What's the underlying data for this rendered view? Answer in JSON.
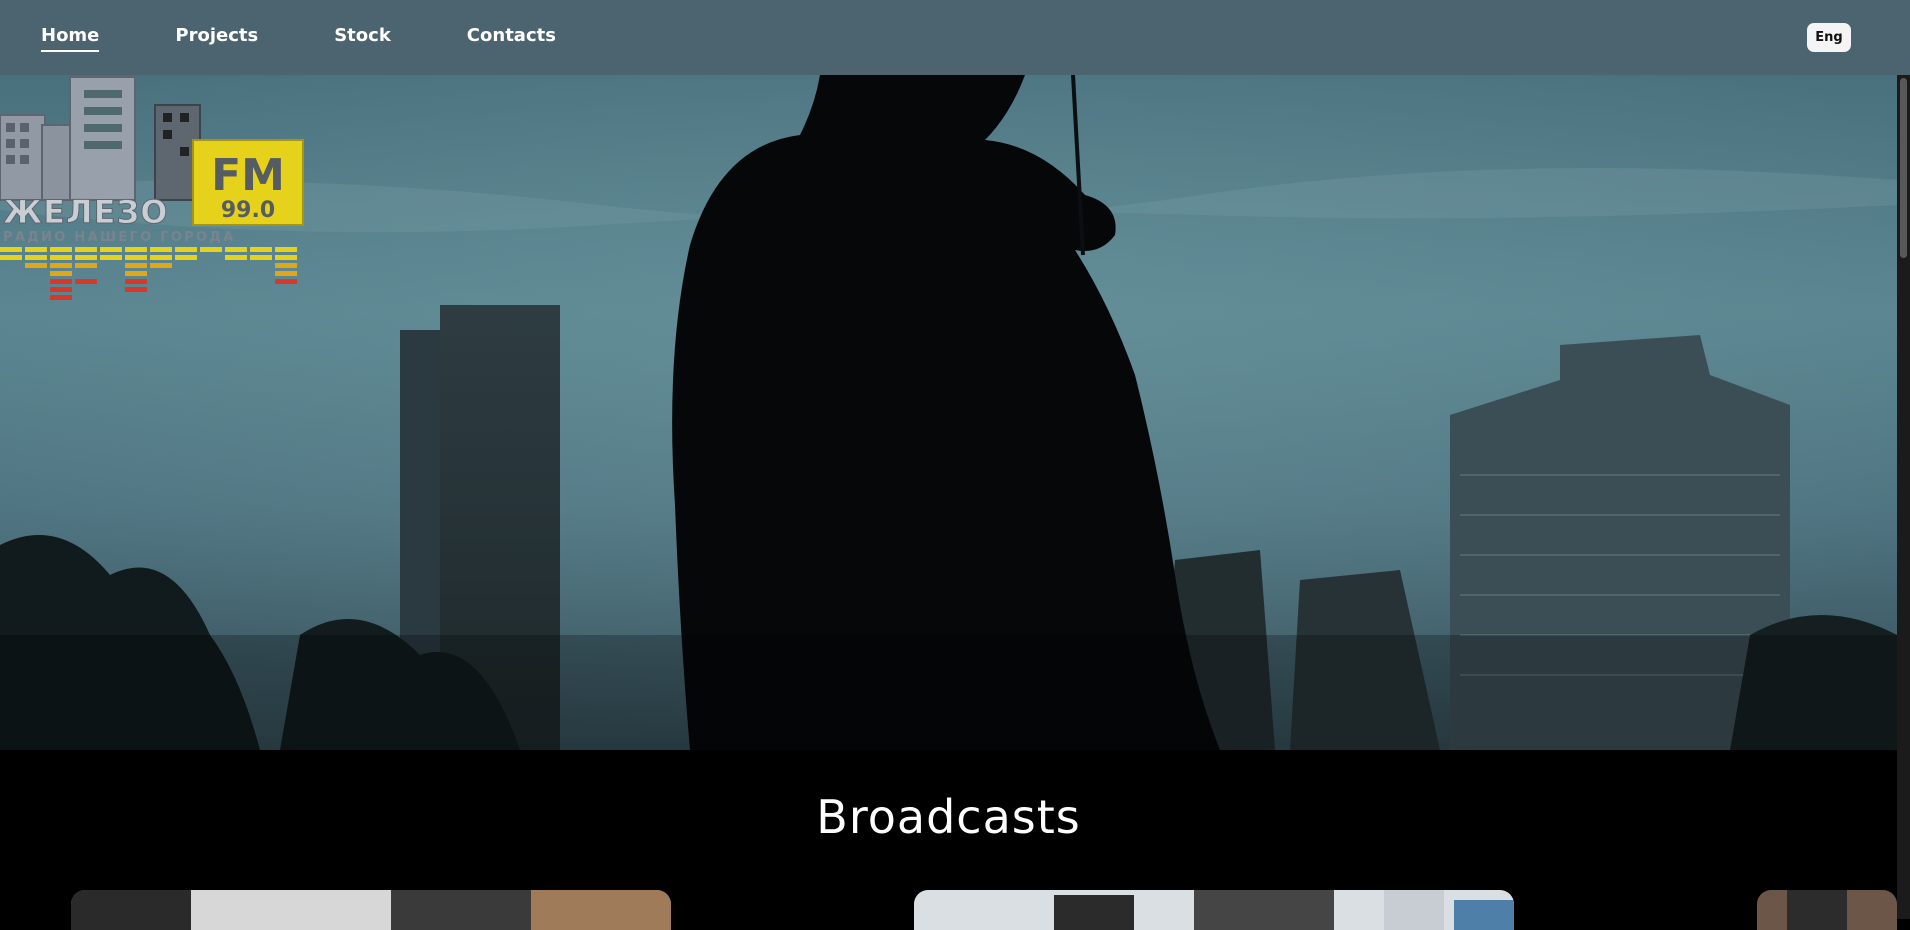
{
  "nav": {
    "items": [
      {
        "label": "Home",
        "active": true
      },
      {
        "label": "Projects",
        "active": false
      },
      {
        "label": "Stock",
        "active": false
      },
      {
        "label": "Contacts",
        "active": false
      }
    ],
    "lang_label": "Eng"
  },
  "hero": {
    "logo": {
      "name": "ЖЕЛЕЗО",
      "fm": "FM",
      "frequency": "99.0",
      "tagline": "РАДИО НАШЕГО ГОРОДА"
    }
  },
  "broadcasts": {
    "title": "Broadcasts",
    "cards": [
      {
        "thumb": "studio-photo-1"
      },
      {
        "thumb": "studio-photo-2"
      },
      {
        "thumb": "studio-photo-3"
      }
    ]
  },
  "colors": {
    "topbar": "#4b6470",
    "page_background": "#000000",
    "logo_yellow": "#e6d21a",
    "logo_gray": "#8f98a3"
  }
}
